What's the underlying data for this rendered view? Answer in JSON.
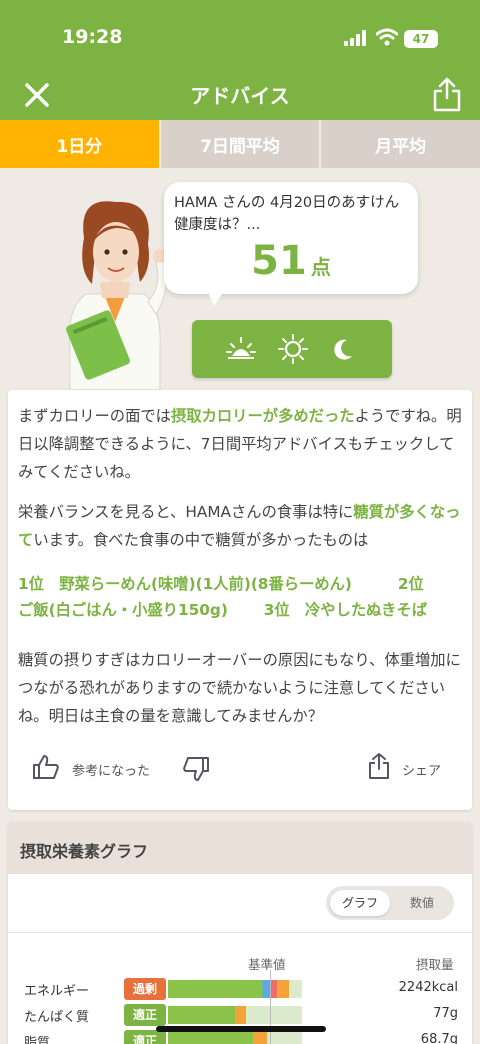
{
  "status_bar": {
    "time": "19:28",
    "battery": "47"
  },
  "nav": {
    "title": "アドバイス",
    "close_icon": "close-icon",
    "share_icon": "share-icon"
  },
  "tabs": [
    {
      "label": "1日分",
      "active": true
    },
    {
      "label": "7日間平均",
      "active": false
    },
    {
      "label": "月平均",
      "active": false
    }
  ],
  "bubble": {
    "text": "HAMA さんの 4月20日のあすけん健康度は？...",
    "score": "51",
    "score_unit": "点"
  },
  "time_icons": [
    "sunrise-icon",
    "sun-icon",
    "moon-icon"
  ],
  "advice": {
    "p1_pre": "まずカロリーの面では",
    "p1_hl": "摂取カロリーが多めだった",
    "p1_post": "ようですね。明日以降調整できるように、7日間平均アドバイスもチェックしてみてくださいね。",
    "p2_pre": "栄養バランスを見ると、HAMAさんの食事は特に",
    "p2_hl": "糖質が多くなって",
    "p2_post": "います。食べた食事の中で糖質が多かったものは",
    "ranking_line1": "1位　野菜らーめん(味噌)(1人前)(8番らーめん)　　　2位",
    "ranking_line2": "ご飯(白ごはん・小盛り150g)　　 3位　冷やしたぬきそば",
    "p3": "糖質の摂りすぎはカロリーオーバーの原因にもなり、体重増加につながる恐れがありますので続かないように注意してくださいね。明日は主食の量を意識してみませんか？"
  },
  "actions": {
    "helpful": "参考になった",
    "share": "シェア"
  },
  "nutrients": {
    "title": "摂取栄養素グラフ",
    "toggle": {
      "graph": "グラフ",
      "values": "数値"
    },
    "col_standard": "基準値",
    "col_intake": "摂取量",
    "rows": [
      {
        "name": "エネルギー",
        "status": "過剰",
        "status_color": "#e8703a",
        "value": "2242kcal",
        "ratio": 0.9
      },
      {
        "name": "たんぱく質",
        "status": "適正",
        "status_color": "#7cb342",
        "value": "77g",
        "ratio": 0.58
      },
      {
        "name": "脂質",
        "status": "適正",
        "status_color": "#7cb342",
        "value": "68.7g",
        "ratio": 0.74
      }
    ]
  },
  "colors": {
    "brand_green": "#7cb342",
    "tab_active": "#ffb300",
    "tab_inactive": "#d9d1c9",
    "warning": "#e8703a"
  }
}
